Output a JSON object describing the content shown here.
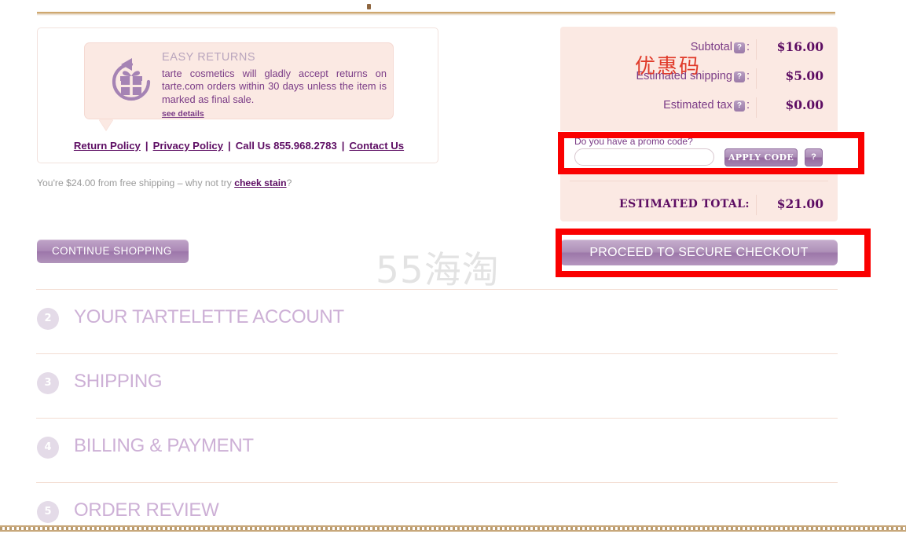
{
  "decor": {
    "watermark": "55海淘",
    "top_strip": "wood-texture-strip",
    "bottom_border": "dotted-rope-border"
  },
  "returns_card": {
    "icon": "gift-return-icon",
    "title": "EASY RETURNS",
    "body": "tarte cosmetics will gladly accept returns on tarte.com orders within 30 days unless the item is marked as final sale.",
    "see_details": "see details",
    "links": {
      "return_policy": "Return Policy",
      "privacy_policy": "Privacy Policy",
      "call_us": "Call Us 855.968.2783",
      "contact_us": "Contact Us",
      "separator": "|"
    }
  },
  "shipping_note": {
    "prefix": "You're $24.00 from free shipping – why not try ",
    "link": "cheek stain",
    "suffix": "?"
  },
  "buttons": {
    "continue_shopping": "CONTINUE SHOPPING",
    "proceed_checkout": "PROCEED TO SECURE CHECKOUT",
    "apply_code": "APPLY CODE"
  },
  "summary": {
    "rows": [
      {
        "label": "Subtotal",
        "help": "?",
        "colon": ":",
        "amount": "$16.00"
      },
      {
        "label": "Estimated shipping",
        "help": "?",
        "colon": ":",
        "amount": "$5.00"
      },
      {
        "label": "Estimated tax",
        "help": "?",
        "colon": ":",
        "amount": "$0.00"
      }
    ],
    "total_label": "ESTIMATED TOTAL:",
    "total_amount": "$21.00"
  },
  "promo": {
    "label": "Do you have a promo code?",
    "input_value": "",
    "input_placeholder": "",
    "help": "?",
    "annotation_cn": "优惠码"
  },
  "steps": [
    {
      "number": "2",
      "title": "YOUR TARTELETTE ACCOUNT"
    },
    {
      "number": "3",
      "title": "SHIPPING"
    },
    {
      "number": "4",
      "title": "BILLING & PAYMENT"
    },
    {
      "number": "5",
      "title": "ORDER REVIEW"
    }
  ],
  "colors": {
    "brand_purple": "#5d0d63",
    "light_purple": "#cdb0d6",
    "panel_pink": "#fbe9e3",
    "annotation_red": "#fa0000",
    "annotation_text_red": "#e03a2a"
  }
}
